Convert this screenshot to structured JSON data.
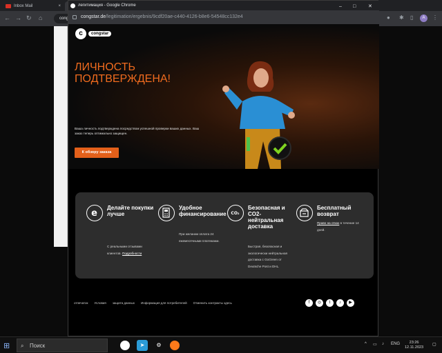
{
  "browser": {
    "tabs": [
      {
        "label": "Inbox Mail",
        "close": "×"
      },
      {
        "label": "",
        "close": "×"
      }
    ],
    "new_tab": "+",
    "address": "congstar.de/legitimation/ergebnis/9cdf20ae-c440-4126-b8e6-54548cc132e4",
    "address_truncated": "cong",
    "profile_initial": "A"
  },
  "popup": {
    "title": "легитимация - Google Chrome",
    "controls": {
      "minimize": "–",
      "maximize": "□",
      "close": "✕"
    },
    "url_host": "congstar.de",
    "url_path": "/legitimation/ergebnis/9cdf20ae-c440-4126-b8e6-54548cc132e4"
  },
  "hero": {
    "logo_mark": "c",
    "logo_text": "congstar",
    "headline": "ЛИЧНОСТЬ ПОДТВЕРЖДЕНА!",
    "subtext": "Ваша личность подтверждена посредством успешной проверки ваших данных. Ваш заказ теперь оптимально защищен.",
    "cta": "К обзору заказа",
    "check_mark": "✓"
  },
  "features": [
    {
      "icon": "e-icon",
      "glyph": "e",
      "title": "Делайте покупки лучше",
      "body": "С реальными отзывами клиентов.",
      "link": "Подробности"
    },
    {
      "icon": "calculator-icon",
      "glyph": "▦",
      "title": "Удобное финансирование",
      "body": "При желании оплата 24 ежемесячными платежами.",
      "link": ""
    },
    {
      "icon": "co2-icon",
      "glyph": "CO₂",
      "title": "Безопасная и CO2-нейтральная доставка",
      "body": "Быстрая, безопасная и экологически нейтральная доставка с GoGreen от Deutsche Post и DHL.",
      "link": ""
    },
    {
      "icon": "return-box-icon",
      "glyph": "▣",
      "title": "Бесплатный возврат",
      "body": "в течение 14 дней.",
      "link": "Право на отказ"
    }
  ],
  "footer": {
    "links": [
      "отпечаток",
      "Условия",
      "защита данных",
      "Информация для потребителей",
      "Отменить контракты здесь"
    ],
    "social": [
      "f",
      "◎",
      "t",
      "♪",
      "▶"
    ]
  },
  "taskbar": {
    "search_placeholder": "Поиск",
    "lang": "ENG",
    "time": "23:26",
    "date": "12.11.2023"
  },
  "colors": {
    "accent": "#f06b1e",
    "cta": "#e3601a",
    "panel": "#2d2d2d"
  }
}
